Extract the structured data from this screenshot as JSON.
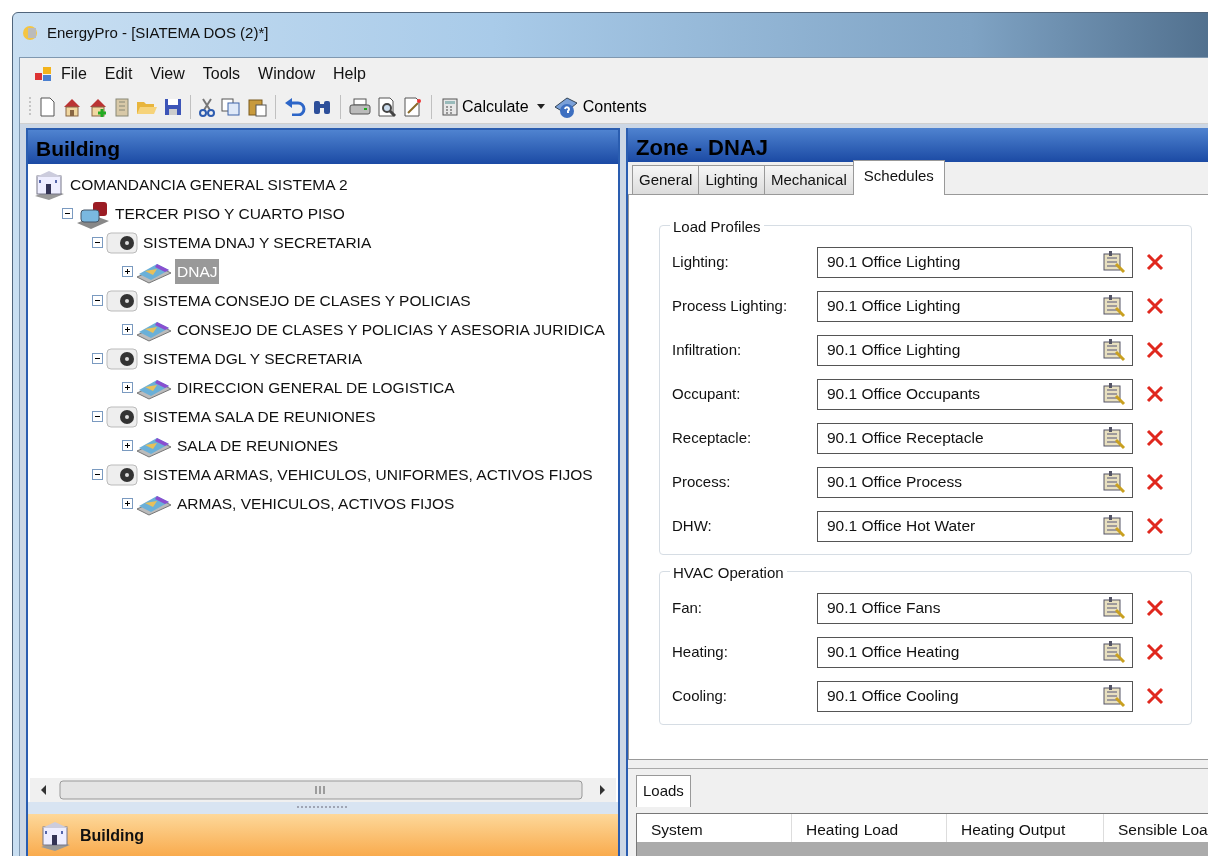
{
  "window": {
    "title": "EnergyPro - [SIATEMA DOS (2)*]"
  },
  "menu": [
    {
      "label": "File"
    },
    {
      "label": "Edit"
    },
    {
      "label": "View"
    },
    {
      "label": "Tools"
    },
    {
      "label": "Window"
    },
    {
      "label": "Help"
    }
  ],
  "toolbar": {
    "buttons": [
      {
        "label": "Calculate",
        "kind": "calculate"
      },
      {
        "label": "Contents",
        "kind": "help"
      }
    ]
  },
  "building_panel": {
    "title": "Building",
    "tree": [
      {
        "label": "COMANDANCIA GENERAL SISTEMA 2",
        "kind": "site",
        "selected": false,
        "children": [
          {
            "label": "TERCER PISO Y CUARTO PISO",
            "kind": "building",
            "expanded": true,
            "selected": false,
            "children": [
              {
                "label": "SISTEMA DNAJ Y SECRETARIA",
                "kind": "system",
                "expanded": true,
                "selected": false,
                "children": [
                  {
                    "label": "DNAJ",
                    "kind": "zone",
                    "expanded": false,
                    "selected": true
                  }
                ]
              },
              {
                "label": "SISTEMA CONSEJO DE CLASES Y POLICIAS",
                "kind": "system",
                "expanded": true,
                "selected": false,
                "children": [
                  {
                    "label": "CONSEJO DE CLASES Y POLICIAS Y ASESORIA JURIDICA",
                    "kind": "zone",
                    "expanded": false,
                    "selected": false
                  }
                ]
              },
              {
                "label": "SISTEMA DGL Y SECRETARIA",
                "kind": "system",
                "expanded": true,
                "selected": false,
                "children": [
                  {
                    "label": "DIRECCION GENERAL DE LOGISTICA",
                    "kind": "zone",
                    "expanded": false,
                    "selected": false
                  }
                ]
              },
              {
                "label": "SISTEMA SALA DE REUNIONES",
                "kind": "system",
                "expanded": true,
                "selected": false,
                "children": [
                  {
                    "label": "SALA DE REUNIONES",
                    "kind": "zone",
                    "expanded": false,
                    "selected": false
                  }
                ]
              },
              {
                "label": "SISTEMA ARMAS, VEHICULOS, UNIFORMES, ACTIVOS FIJOS",
                "kind": "system",
                "expanded": true,
                "selected": false,
                "children": [
                  {
                    "label": "ARMAS, VEHICULOS, ACTIVOS FIJOS",
                    "kind": "zone",
                    "expanded": false,
                    "selected": false
                  }
                ]
              }
            ]
          }
        ]
      }
    ],
    "nav_bar": {
      "label": "Building"
    }
  },
  "zone_panel": {
    "title": "Zone - DNAJ",
    "tabs": [
      {
        "label": "General",
        "selected": false
      },
      {
        "label": "Lighting",
        "selected": false
      },
      {
        "label": "Mechanical",
        "selected": false
      },
      {
        "label": "Schedules",
        "selected": true
      }
    ],
    "groups": [
      {
        "title": "Load Profiles",
        "rows": [
          {
            "label": "Lighting:",
            "value": "90.1 Office Lighting"
          },
          {
            "label": "Process Lighting:",
            "value": "90.1 Office Lighting"
          },
          {
            "label": "Infiltration:",
            "value": "90.1 Office Lighting"
          },
          {
            "label": "Occupant:",
            "value": "90.1 Office Occupants"
          },
          {
            "label": "Receptacle:",
            "value": "90.1 Office Receptacle"
          },
          {
            "label": "Process:",
            "value": "90.1 Office Process"
          },
          {
            "label": "DHW:",
            "value": "90.1 Office Hot Water"
          }
        ]
      },
      {
        "title": "HVAC Operation",
        "rows": [
          {
            "label": "Fan:",
            "value": "90.1 Office Fans"
          },
          {
            "label": "Heating:",
            "value": "90.1 Office Heating"
          },
          {
            "label": "Cooling:",
            "value": "90.1 Office Cooling"
          }
        ]
      }
    ]
  },
  "loads_panel": {
    "tabs": [
      {
        "label": "Loads",
        "selected": true
      }
    ],
    "table": {
      "columns": [
        "System",
        "Heating Load",
        "Heating Output",
        "Sensible Loa"
      ]
    }
  }
}
